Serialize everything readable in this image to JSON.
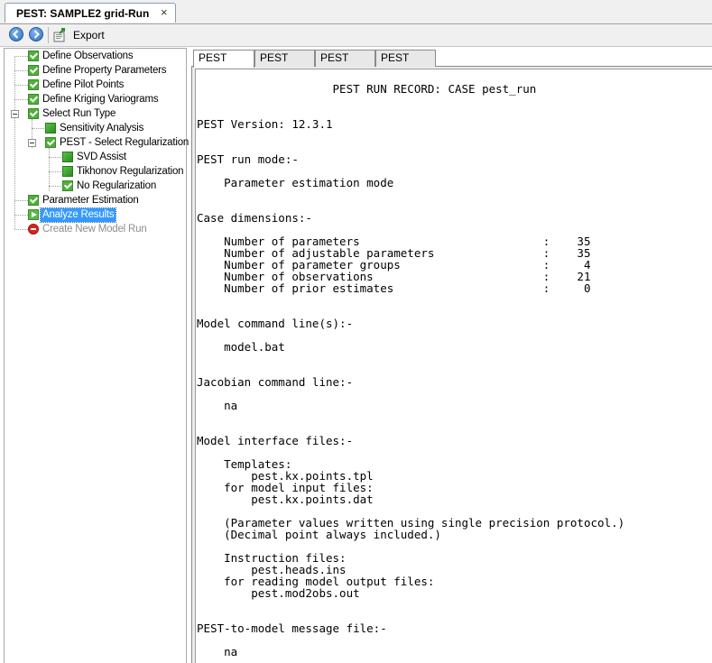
{
  "document_tab": {
    "title": "PEST: SAMPLE2 grid-Run",
    "close_glyph": "×"
  },
  "toolbar": {
    "back_icon": "back-arrow-icon",
    "forward_icon": "forward-arrow-icon",
    "export_icon": "export-icon",
    "export_label": "Export"
  },
  "tree": {
    "items": [
      {
        "label": "Define Observations",
        "icon": "check-icon"
      },
      {
        "label": "Define Property Parameters",
        "icon": "check-icon"
      },
      {
        "label": "Define Pilot Points",
        "icon": "check-icon"
      },
      {
        "label": "Define Kriging Variograms",
        "icon": "check-icon"
      },
      {
        "label": "Select Run Type",
        "icon": "check-icon"
      },
      {
        "label": "Sensitivity Analysis",
        "icon": "square-icon"
      },
      {
        "label": "PEST - Select Regularization",
        "icon": "check-icon"
      },
      {
        "label": "SVD Assist",
        "icon": "square-icon"
      },
      {
        "label": "Tikhonov Regularization",
        "icon": "square-icon"
      },
      {
        "label": "No Regularization",
        "icon": "check-icon"
      },
      {
        "label": "Parameter Estimation",
        "icon": "check-icon"
      },
      {
        "label": "Analyze Results",
        "icon": "arrow-icon",
        "selected": true
      },
      {
        "label": "Create New Model Run",
        "icon": "stop-icon",
        "disabled": true
      }
    ]
  },
  "content_tabs": [
    "PEST .REC",
    "PEST .SEO",
    "PEST .SEN",
    "PEST .RES"
  ],
  "active_content_tab": "PEST .REC",
  "record_lines": [
    "                    PEST RUN RECORD: CASE pest_run",
    "PEST Version: 12.3.1",
    "PEST run mode:-",
    "    Parameter estimation mode",
    "Case dimensions:-",
    "    Number of parameters                           :    35",
    "    Number of adjustable parameters                :    35",
    "    Number of parameter groups                     :     4",
    "    Number of observations                         :    21",
    "    Number of prior estimates                      :     0",
    "Model command line(s):-",
    "    model.bat",
    "Jacobian command line:-",
    "    na",
    "Model interface files:-",
    "    Templates:",
    "        pest.kx.points.tpl",
    "    for model input files:",
    "        pest.kx.points.dat",
    "    (Parameter values written using single precision protocol.)",
    "    (Decimal point always included.)",
    "    Instruction files:",
    "        pest.heads.ins",
    "    for reading model output files:",
    "        pest.mod2obs.out",
    "PEST-to-model message file:-",
    "    na"
  ]
}
